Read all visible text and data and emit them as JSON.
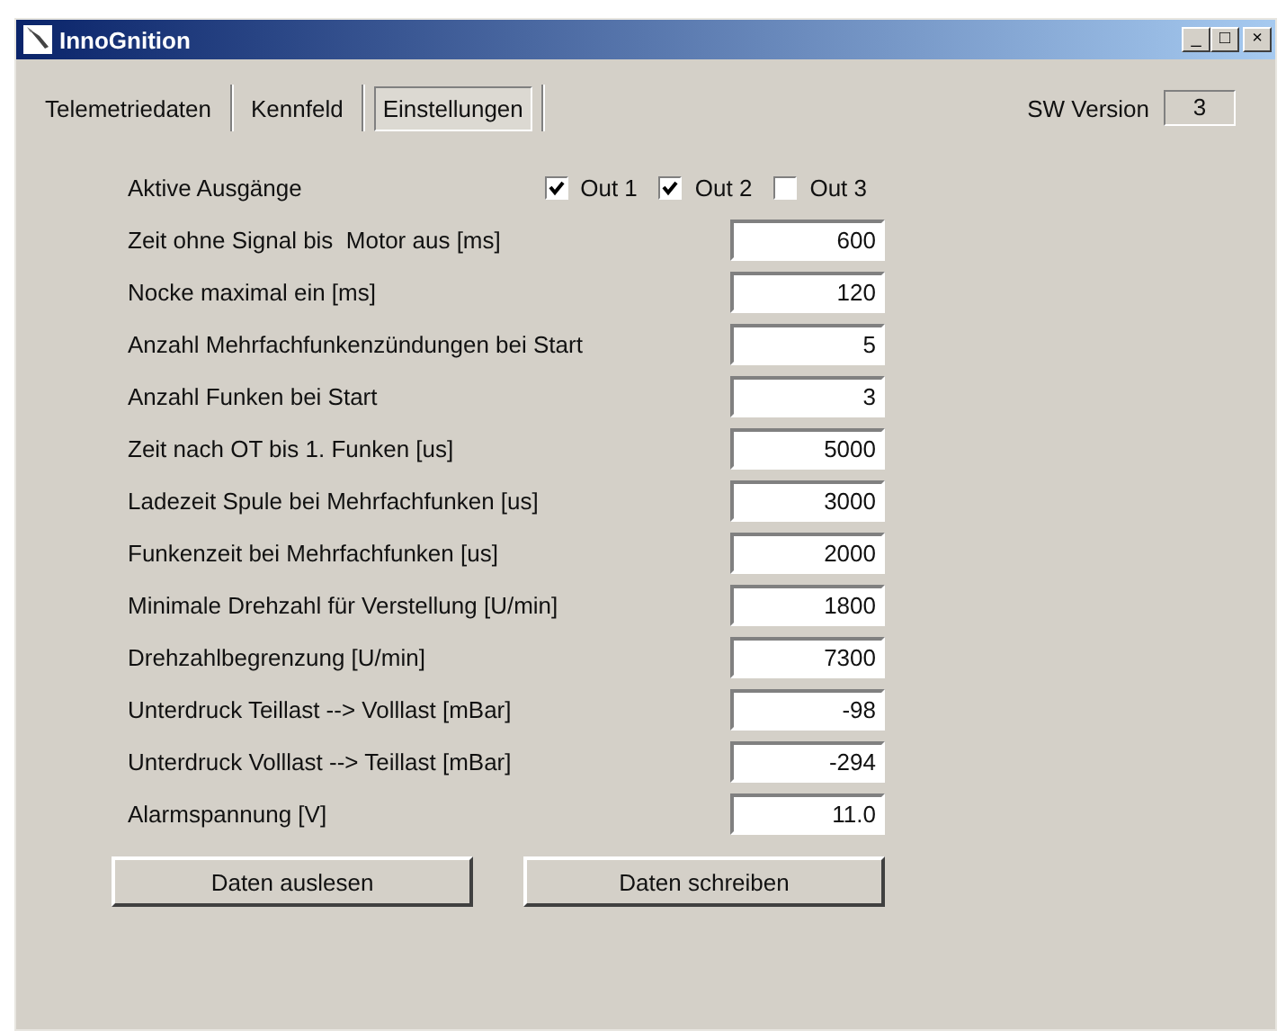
{
  "window": {
    "title": "InnoGnition",
    "controls": [
      "_",
      "□",
      "×"
    ]
  },
  "tabs": [
    {
      "label": "Telemetriedaten",
      "selected": false
    },
    {
      "label": "Kennfeld",
      "selected": false
    },
    {
      "label": "Einstellungen",
      "selected": true
    }
  ],
  "sw_version": {
    "label": "SW Version",
    "value": "3"
  },
  "outputs": {
    "label": "Aktive Ausgänge",
    "items": [
      {
        "label": "Out 1",
        "checked": true
      },
      {
        "label": "Out 2",
        "checked": true
      },
      {
        "label": "Out 3",
        "checked": false
      }
    ]
  },
  "settings": [
    {
      "label": "Zeit ohne Signal bis  Motor aus [ms]",
      "value": "600"
    },
    {
      "label": "Nocke maximal ein [ms]",
      "value": "120"
    },
    {
      "label": "Anzahl Mehrfachfunkenzündungen bei Start",
      "value": "5"
    },
    {
      "label": "Anzahl Funken bei Start",
      "value": "3"
    },
    {
      "label": "Zeit nach OT bis 1. Funken [us]",
      "value": "5000"
    },
    {
      "label": "Ladezeit Spule bei Mehrfachfunken [us]",
      "value": "3000"
    },
    {
      "label": "Funkenzeit bei Mehrfachfunken [us]",
      "value": "2000"
    },
    {
      "label": "Minimale Drehzahl für Verstellung [U/min]",
      "value": "1800"
    },
    {
      "label": "Drehzahlbegrenzung [U/min]",
      "value": "7300"
    },
    {
      "label": "Unterdruck Teillast --> Volllast [mBar]",
      "value": "-98"
    },
    {
      "label": "Unterdruck Volllast --> Teillast [mBar]",
      "value": "-294"
    },
    {
      "label": "Alarmspannung [V]",
      "value": "11.0"
    }
  ],
  "buttons": [
    "Daten auslesen",
    "Daten schreiben"
  ]
}
